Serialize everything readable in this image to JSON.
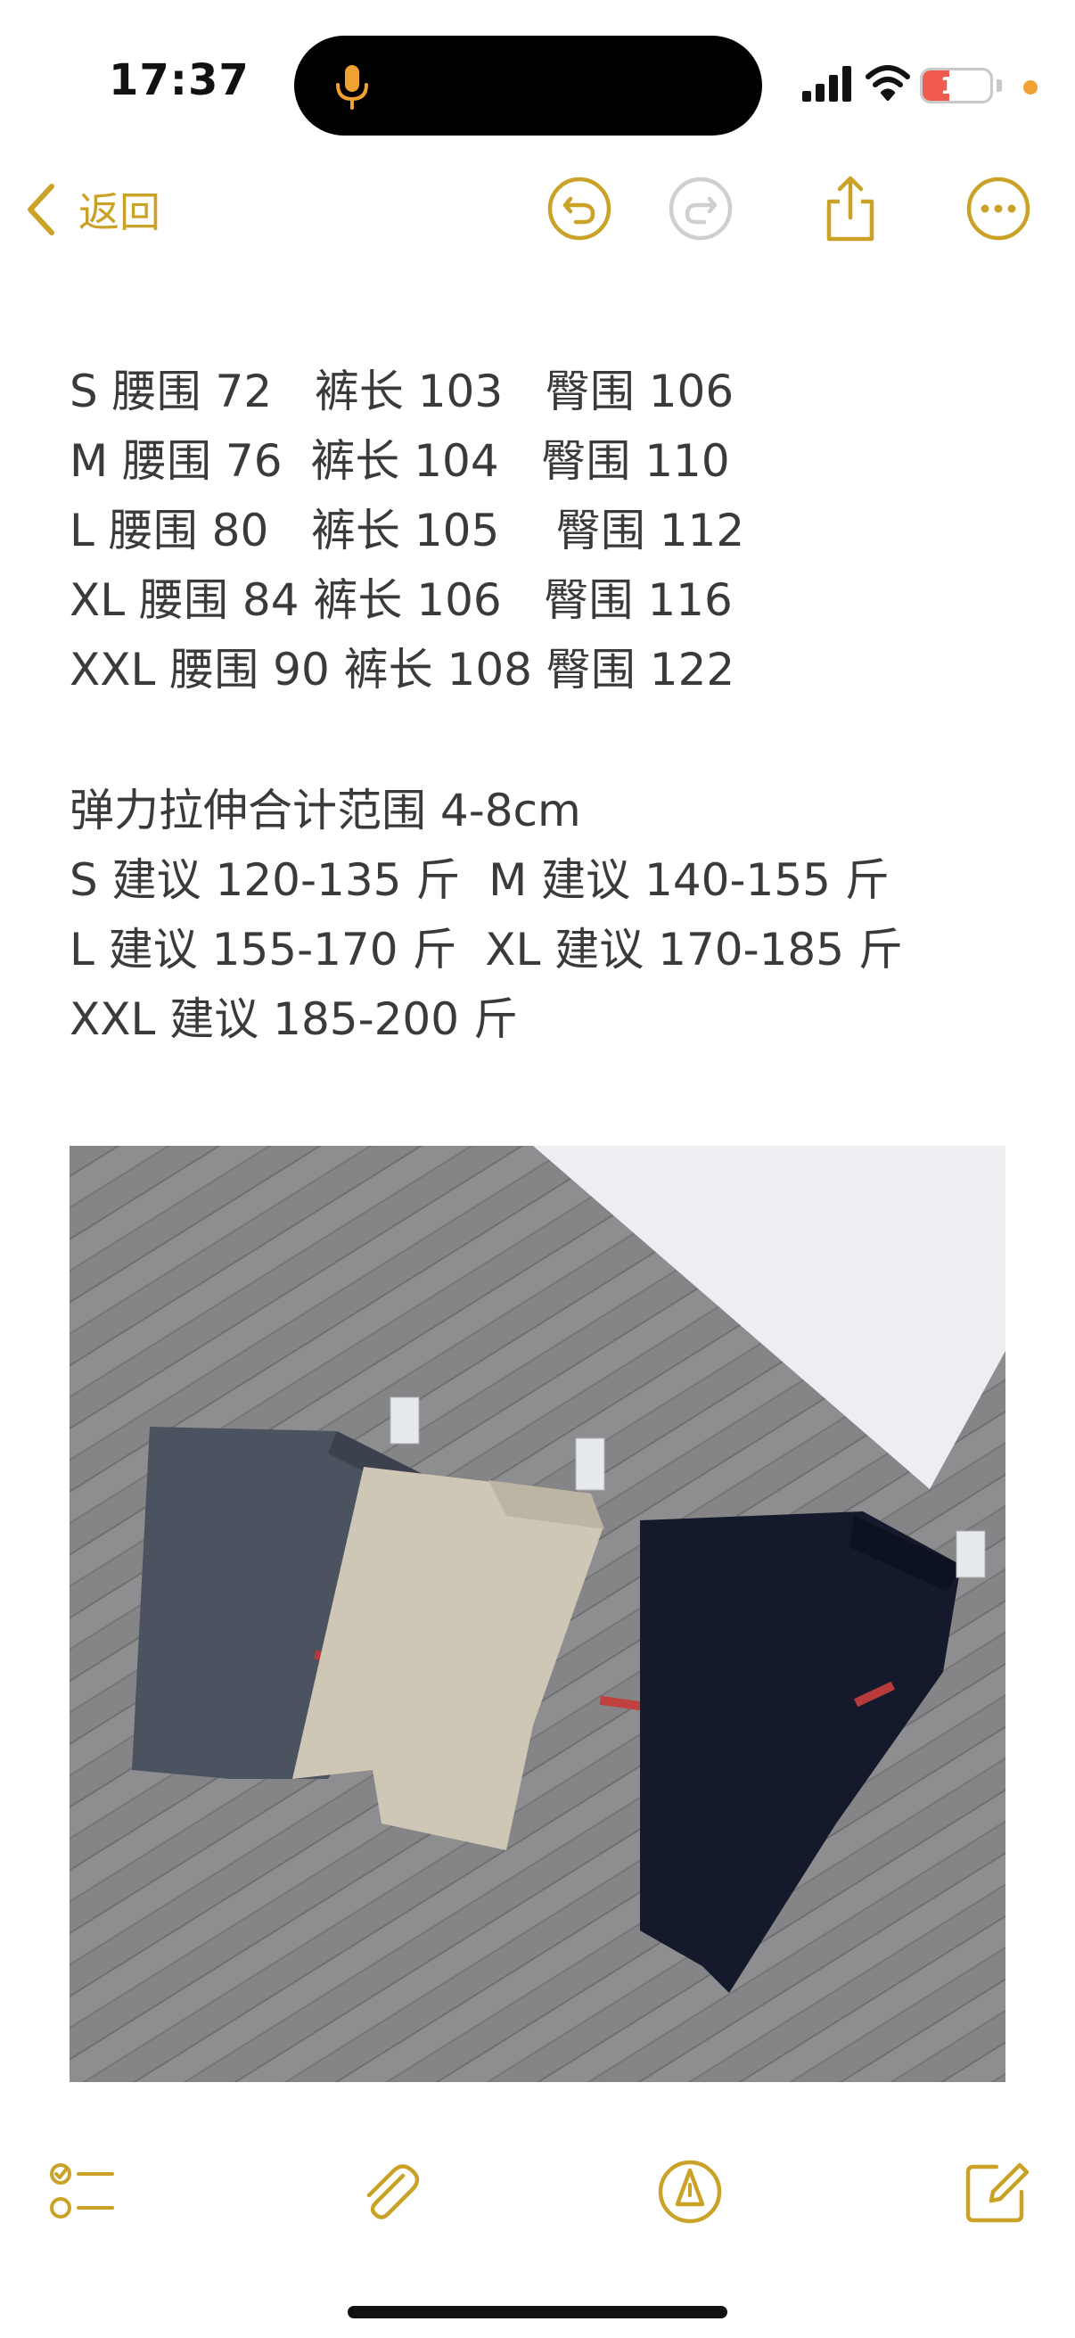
{
  "status": {
    "time": "17:37",
    "battery_level": "14",
    "battery_color": "#f05a4f",
    "mic_color": "#f0a132",
    "icons": [
      "microphone-icon",
      "cellular-signal-icon",
      "wifi-icon",
      "battery-icon",
      "privacy-dot"
    ]
  },
  "nav": {
    "back_label": "返回",
    "accent_color": "#c9a227",
    "icons": [
      "chevron-left-icon",
      "undo-icon",
      "redo-icon",
      "share-icon",
      "more-icon"
    ]
  },
  "note": {
    "size_lines": [
      "S 腰围 72   裤长 103   臀围 106",
      "M 腰围 76  裤长 104   臀围 110",
      "L 腰围 80   裤长 105    臀围 112",
      "XL 腰围 84 裤长 106   臀围 116",
      "XXL 腰围 90 裤长 108 臀围 122"
    ],
    "recommend_lines": [
      "弹力拉伸合计范围 4-8cm",
      "S 建议 120-135 斤  M 建议 140-155 斤",
      "L 建议 155-170 斤  XL 建议 170-185 斤",
      "XXL 建议 185-200 斤"
    ]
  },
  "toolbar": {
    "icons": [
      "checklist-icon",
      "attachment-icon",
      "markup-pen-icon",
      "compose-icon"
    ]
  }
}
